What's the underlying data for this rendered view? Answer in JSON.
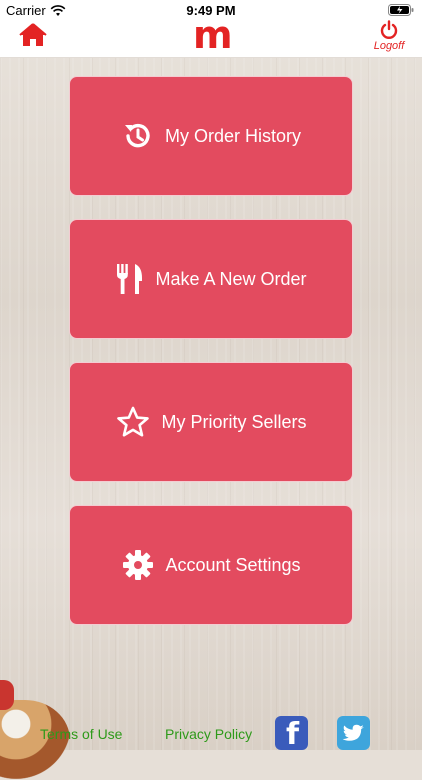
{
  "status_bar": {
    "carrier": "Carrier",
    "time": "9:49 PM"
  },
  "header": {
    "logo_text": "m",
    "logoff_label": "Logoff",
    "brand_color": "#e32323"
  },
  "menu": {
    "items": [
      {
        "label": "My Order History",
        "icon": "history-icon"
      },
      {
        "label": "Make A New Order",
        "icon": "fork-knife-icon"
      },
      {
        "label": "My Priority Sellers",
        "icon": "star-icon"
      },
      {
        "label": "Account Settings",
        "icon": "gear-icon"
      }
    ],
    "tile_color": "#e34b5f"
  },
  "footer": {
    "terms_label": "Terms of Use",
    "privacy_label": "Privacy Policy",
    "facebook_icon": "facebook-icon",
    "twitter_icon": "twitter-icon",
    "link_color": "#2e9a1a"
  }
}
